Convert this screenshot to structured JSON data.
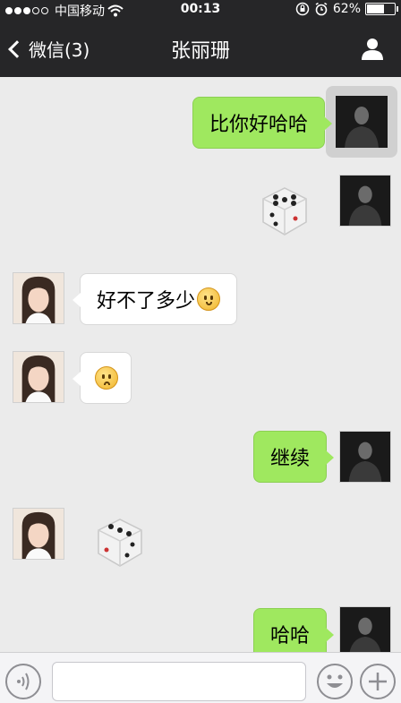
{
  "status_bar": {
    "carrier": "中国移动",
    "time": "00:13",
    "battery_percent": "62%",
    "battery_level": 0.62,
    "signal_bars_filled": 3,
    "signal_bars_total": 5
  },
  "nav": {
    "back_label": "微信(3)",
    "title": "张丽珊"
  },
  "messages": [
    {
      "sender": "me",
      "type": "text",
      "text": "比你好哈哈"
    },
    {
      "sender": "me",
      "type": "dice",
      "dice_value": 5
    },
    {
      "sender": "her",
      "type": "text",
      "text": "好不了多少",
      "emoji": "thinking-emoji"
    },
    {
      "sender": "her",
      "type": "emoji",
      "emoji": "frown-emoji"
    },
    {
      "sender": "me",
      "type": "text",
      "text": "继续"
    },
    {
      "sender": "her",
      "type": "dice",
      "dice_value": 3
    },
    {
      "sender": "me",
      "type": "text",
      "text": "哈哈"
    }
  ],
  "input": {
    "value": "",
    "placeholder": ""
  },
  "icons": {
    "voice": "voice-icon",
    "emoji": "emoji-icon",
    "plus": "plus-icon",
    "profile": "person-icon",
    "back": "chevron-left-icon"
  },
  "colors": {
    "bar_bg": "#262628",
    "chat_bg": "#ebebeb",
    "sent_bubble": "#9fe85f",
    "received_bubble": "#ffffff"
  }
}
